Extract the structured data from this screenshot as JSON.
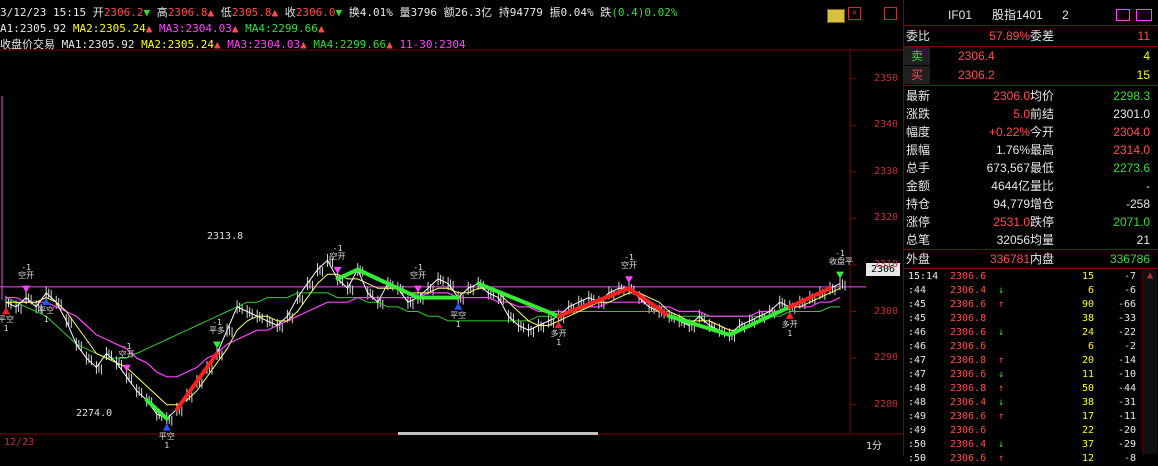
{
  "header": {
    "date_time": "3/12/23 15:15",
    "open_label": "开",
    "open_value": "2306.2",
    "high_label": "高",
    "high_value": "2306.8",
    "low_label": "低",
    "low_value": "2305.8",
    "close_label": "收",
    "close_value": "2306.0",
    "turnover_label": "换",
    "turnover_value": "4.01%",
    "volume_label": "量",
    "volume_value": "3796",
    "amount_label": "额",
    "amount_value": "26.3亿",
    "oi_label": "持",
    "oi_value": "94779",
    "amplitude_label": "振",
    "amplitude_value": "0.04%",
    "change_label": "跌",
    "change_value": "(0.4)0.02%"
  },
  "ma_line1": {
    "ma1": "A1:2305.92",
    "ma2": "MA2:2305.24",
    "ma3": "MA3:2304.03",
    "ma4": "MA4:2299.66"
  },
  "ma_line2": {
    "title": "收盘价交易",
    "ma1": "MA1:2305.92",
    "ma2": "MA2:2305.24",
    "ma3": "MA3:2304.03",
    "ma4": "MA4:2299.66",
    "date": "11-30:2304"
  },
  "chart_labels": {
    "high_marker": "2313.8",
    "low_marker": "2274.0",
    "current_price_tag": "2306",
    "bottom_date": "12/23",
    "period_label": "1分"
  },
  "chart_data": {
    "type": "line",
    "ylim": [
      2275,
      2354
    ],
    "y_ticks": [
      "2350",
      "2340",
      "2330",
      "2320",
      "2310",
      "2300",
      "2290",
      "2280"
    ],
    "y_tick_values": [
      2350,
      2340,
      2330,
      2320,
      2310,
      2300,
      2290,
      2280
    ],
    "current_price": 2305.3,
    "price": [
      2302,
      2301,
      2303,
      2301,
      2304,
      2302,
      2298,
      2293,
      2290,
      2288,
      2291,
      2289,
      2286,
      2283,
      2281,
      2278,
      2277,
      2279,
      2282,
      2285,
      2288,
      2291,
      2296,
      2301,
      2300,
      2299,
      2298,
      2297,
      2299,
      2303,
      2306,
      2309,
      2311,
      2307,
      2305,
      2309,
      2304,
      2302,
      2306,
      2305,
      2302,
      2303,
      2305,
      2307,
      2306,
      2303,
      2305,
      2306,
      2304,
      2303,
      2299,
      2297,
      2296,
      2297,
      2298,
      2299,
      2301,
      2302,
      2303,
      2302,
      2304,
      2305,
      2305,
      2303,
      2301,
      2300,
      2299,
      2298,
      2297,
      2299,
      2297,
      2296,
      2295,
      2297,
      2298,
      2299,
      2300,
      2302,
      2301,
      2302,
      2303,
      2304,
      2305,
      2306
    ],
    "ma_fast": [
      2302,
      2302,
      2302,
      2302,
      2303,
      2302,
      2300,
      2297,
      2294,
      2291,
      2290,
      2289,
      2288,
      2286,
      2284,
      2282,
      2280,
      2280,
      2281,
      2283,
      2286,
      2289,
      2292,
      2296,
      2298,
      2299,
      2299,
      2298,
      2298,
      2300,
      2303,
      2306,
      2308,
      2308,
      2307,
      2307,
      2306,
      2305,
      2305,
      2305,
      2304,
      2304,
      2304,
      2305,
      2305,
      2304,
      2304,
      2305,
      2305,
      2304,
      2302,
      2300,
      2298,
      2297,
      2297,
      2298,
      2299,
      2300,
      2301,
      2302,
      2302,
      2303,
      2304,
      2304,
      2303,
      2302,
      2300,
      2299,
      2298,
      2298,
      2298,
      2297,
      2296,
      2296,
      2297,
      2298,
      2299,
      2300,
      2301,
      2301,
      2302,
      2303,
      2304,
      2305
    ],
    "ma_slow": [
      2303,
      2303,
      2302,
      2302,
      2302,
      2301,
      2300,
      2299,
      2297,
      2295,
      2294,
      2293,
      2292,
      2290,
      2289,
      2287,
      2286,
      2286,
      2287,
      2288,
      2290,
      2291,
      2293,
      2294,
      2295,
      2296,
      2296,
      2297,
      2298,
      2299,
      2300,
      2301,
      2302,
      2302,
      2302,
      2303,
      2303,
      2303,
      2303,
      2303,
      2303,
      2303,
      2304,
      2304,
      2304,
      2303,
      2303,
      2303,
      2303,
      2302,
      2302,
      2301,
      2301,
      2300,
      2300,
      2300,
      2300,
      2301,
      2301,
      2301,
      2302,
      2302,
      2302,
      2302,
      2302,
      2301,
      2301,
      2300,
      2300,
      2300,
      2299,
      2299,
      2299,
      2299,
      2299,
      2300,
      2300,
      2300,
      2301,
      2301,
      2301,
      2302,
      2302,
      2303
    ],
    "ma_trend": [
      2303,
      2302,
      2301,
      2300,
      2299,
      2297,
      2295,
      2293,
      2292,
      2291,
      2290,
      2290,
      2290,
      2291,
      2292,
      2293,
      2294,
      2295,
      2296,
      2297,
      2298,
      2299,
      2300,
      2301,
      2302,
      2302,
      2303,
      2303,
      2303,
      2304,
      2304,
      2304,
      2304,
      2303,
      2303,
      2303,
      2302,
      2302,
      2301,
      2301,
      2300,
      2300,
      2299,
      2299,
      2298,
      2298,
      2298,
      2298,
      2298,
      2298,
      2298,
      2298,
      2298,
      2299,
      2299,
      2299,
      2300,
      2300,
      2300,
      2300,
      2300,
      2300,
      2300,
      2300,
      2300,
      2300,
      2300,
      2299,
      2299,
      2299,
      2299,
      2299,
      2299,
      2299,
      2299,
      2299,
      2299,
      2299,
      2300,
      2300,
      2300,
      2300,
      2301,
      2301
    ],
    "trade_segments": [
      {
        "from": 14,
        "to": 16,
        "color": "green"
      },
      {
        "from": 17,
        "to": 21,
        "color": "red"
      },
      {
        "from": 33,
        "to": 35,
        "color": "green"
      },
      {
        "from": 35,
        "to": 41,
        "color": "green"
      },
      {
        "from": 41,
        "to": 45,
        "color": "green"
      },
      {
        "from": 47,
        "to": 55,
        "color": "green"
      },
      {
        "from": 55,
        "to": 62,
        "color": "red"
      },
      {
        "from": 62,
        "to": 66,
        "color": "red"
      },
      {
        "from": 66,
        "to": 72,
        "color": "green"
      },
      {
        "from": 72,
        "to": 78,
        "color": "green"
      },
      {
        "from": 78,
        "to": 82,
        "color": "red"
      }
    ]
  },
  "signals": [
    {
      "i": 0,
      "text": "平空",
      "sub": "1",
      "arrow": "up",
      "color": "red",
      "pos": "below"
    },
    {
      "i": 2,
      "text": "-1\n空开",
      "sub": "",
      "arrow": "down",
      "color": "magenta",
      "pos": "above"
    },
    {
      "i": 4,
      "text": "平空",
      "sub": "1",
      "arrow": "up",
      "color": "blue",
      "pos": "below"
    },
    {
      "i": 12,
      "text": "-1\n空开",
      "sub": "",
      "arrow": "down",
      "color": "magenta",
      "pos": "above"
    },
    {
      "i": 16,
      "text": "平空",
      "sub": "1",
      "arrow": "up",
      "color": "blue",
      "pos": "below"
    },
    {
      "i": 21,
      "text": "-1\n平多",
      "sub": "",
      "arrow": "down",
      "color": "green",
      "pos": "above"
    },
    {
      "i": 33,
      "text": "-1\n空开",
      "sub": "",
      "arrow": "down",
      "color": "magenta",
      "pos": "above"
    },
    {
      "i": 41,
      "text": "-1\n空开",
      "sub": "",
      "arrow": "down",
      "color": "magenta",
      "pos": "above"
    },
    {
      "i": 45,
      "text": "平空",
      "sub": "1",
      "arrow": "up",
      "color": "blue",
      "pos": "below"
    },
    {
      "i": 55,
      "text": "多开",
      "sub": "1",
      "arrow": "up",
      "color": "red",
      "pos": "below"
    },
    {
      "i": 62,
      "text": "-1\n空开",
      "sub": "",
      "arrow": "down",
      "color": "magenta",
      "pos": "above"
    },
    {
      "i": 78,
      "text": "多开",
      "sub": "1",
      "arrow": "up",
      "color": "red",
      "pos": "below"
    },
    {
      "i": 83,
      "text": "-1\n收盘平",
      "sub": "",
      "arrow": "down",
      "color": "green",
      "pos": "above"
    }
  ],
  "panel": {
    "symbol": "IF01",
    "name": "股指1401",
    "number": "2",
    "icons": {
      "close": "close-icon",
      "restore": "restore-icon"
    },
    "weibi_label": "委比",
    "weibi_value": "57.89%",
    "weicha_label": "委差",
    "weicha_value": "11",
    "sell_label": "卖",
    "sell_price": "2306.4",
    "sell_qty": "4",
    "buy_label": "买",
    "buy_price": "2306.2",
    "buy_qty": "15",
    "stats": [
      {
        "l1": "最新",
        "v1": "2306.0",
        "c1": "#ff4d4d",
        "l2": "均价",
        "v2": "2298.3",
        "c2": "#33dd33"
      },
      {
        "l1": "涨跌",
        "v1": "5.0",
        "c1": "#ff4d4d",
        "l2": "前结",
        "v2": "2301.0",
        "c2": "#e8e8e8"
      },
      {
        "l1": "幅度",
        "v1": "+0.22%",
        "c1": "#ff4d4d",
        "l2": "今开",
        "v2": "2304.0",
        "c2": "#ff4d4d"
      },
      {
        "l1": "振幅",
        "v1": "1.76%",
        "c1": "#e8e8e8",
        "l2": "最高",
        "v2": "2314.0",
        "c2": "#ff4d4d"
      },
      {
        "l1": "总手",
        "v1": "673,567",
        "c1": "#e8e8e8",
        "l2": "最低",
        "v2": "2273.6",
        "c2": "#33dd33"
      },
      {
        "l1": "金额",
        "v1": "4644亿",
        "c1": "#e8e8e8",
        "l2": "量比",
        "v2": "-",
        "c2": "#e8e8e8"
      },
      {
        "l1": "持仓",
        "v1": "94,779",
        "c1": "#e8e8e8",
        "l2": "增仓",
        "v2": "-258",
        "c2": "#e8e8e8"
      },
      {
        "l1": "涨停",
        "v1": "2531.0",
        "c1": "#ff4d4d",
        "l2": "跌停",
        "v2": "2071.0",
        "c2": "#33dd33"
      },
      {
        "l1": "总笔",
        "v1": "32056",
        "c1": "#e8e8e8",
        "l2": "均量",
        "v2": "21",
        "c2": "#e8e8e8"
      }
    ],
    "outer_label": "外盘",
    "outer_value": "336781",
    "inner_label": "内盘",
    "inner_value": "336786",
    "trades": [
      {
        "t": "15:14",
        "p": "2306.6",
        "d": "",
        "v": "15",
        "oi": "-7"
      },
      {
        "t": ":44",
        "p": "2306.4",
        "d": "↓",
        "v": "6",
        "oi": "-6"
      },
      {
        "t": ":45",
        "p": "2306.6",
        "d": "↑",
        "v": "90",
        "oi": "-66"
      },
      {
        "t": ":45",
        "p": "2306.8",
        "d": "",
        "v": "38",
        "oi": "-33"
      },
      {
        "t": ":46",
        "p": "2306.6",
        "d": "↓",
        "v": "24",
        "oi": "-22"
      },
      {
        "t": ":46",
        "p": "2306.6",
        "d": "",
        "v": "6",
        "oi": "-2"
      },
      {
        "t": ":47",
        "p": "2306.8",
        "d": "↑",
        "v": "20",
        "oi": "-14"
      },
      {
        "t": ":47",
        "p": "2306.6",
        "d": "↓",
        "v": "11",
        "oi": "-10"
      },
      {
        "t": ":48",
        "p": "2306.8",
        "d": "↑",
        "v": "50",
        "oi": "-44"
      },
      {
        "t": ":48",
        "p": "2306.4",
        "d": "↓",
        "v": "38",
        "oi": "-31"
      },
      {
        "t": ":49",
        "p": "2306.6",
        "d": "↑",
        "v": "17",
        "oi": "-11"
      },
      {
        "t": ":49",
        "p": "2306.6",
        "d": "",
        "v": "22",
        "oi": "-20"
      },
      {
        "t": ":50",
        "p": "2306.4",
        "d": "↓",
        "v": "37",
        "oi": "-29"
      },
      {
        "t": ":50",
        "p": "2306.6",
        "d": "↑",
        "v": "12",
        "oi": "-8"
      }
    ]
  }
}
